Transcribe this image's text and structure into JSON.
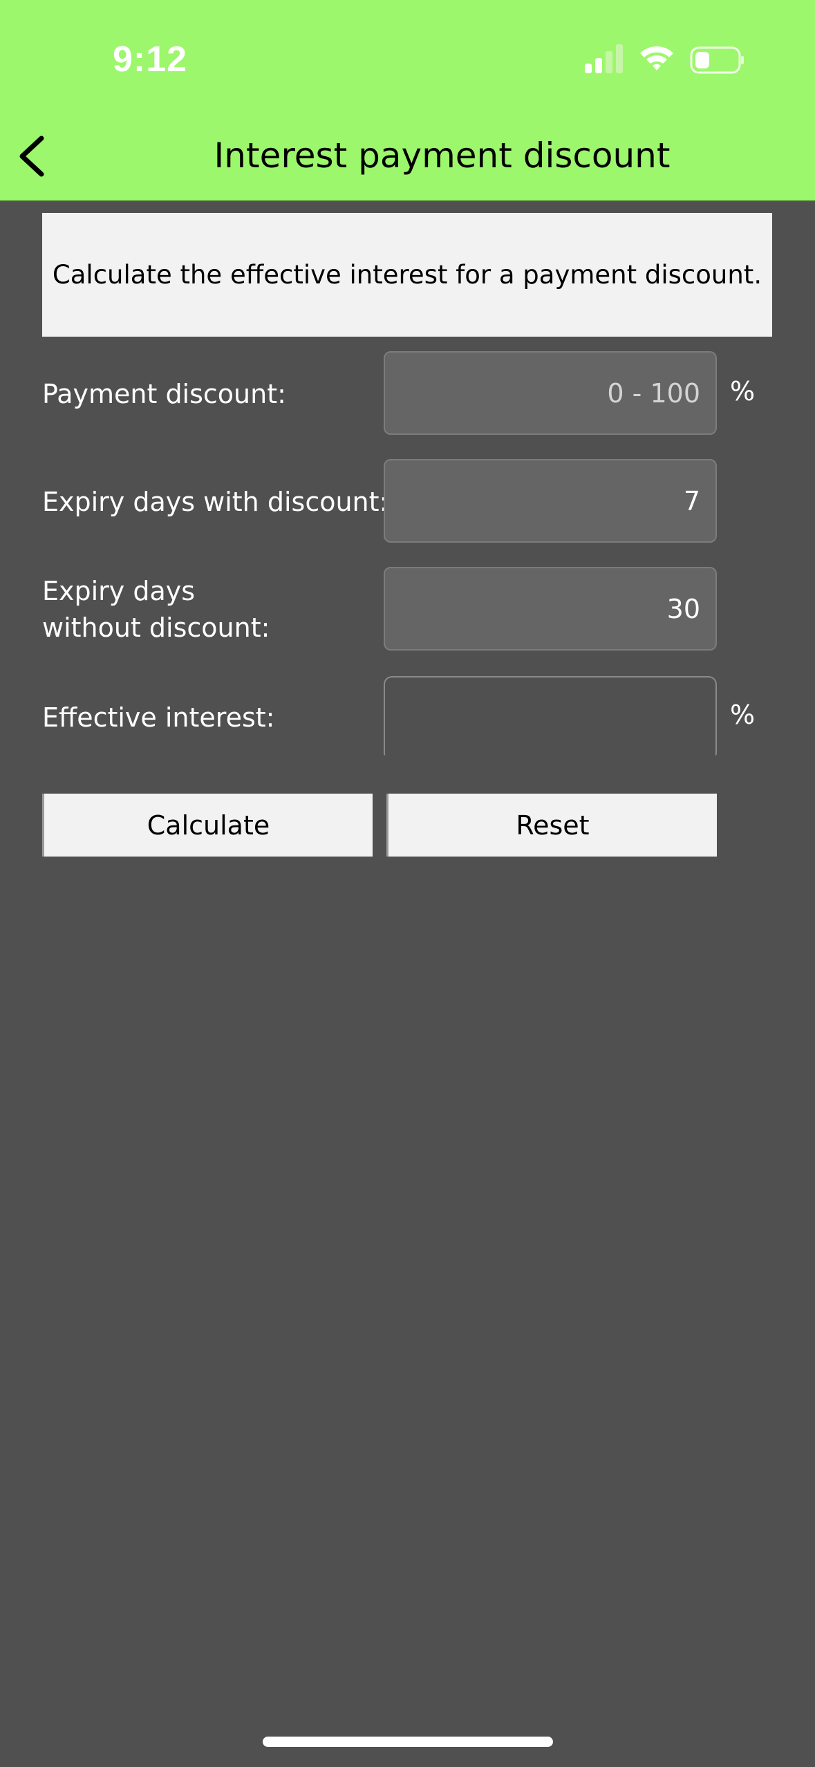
{
  "status_bar": {
    "time": "9:12",
    "icons": [
      "cellular-signal-icon",
      "wifi-icon",
      "battery-icon"
    ]
  },
  "nav": {
    "back_icon": "chevron-left-icon",
    "title": "Interest payment discount"
  },
  "info": {
    "text": "Calculate the effective interest for a payment discount."
  },
  "form": {
    "payment_discount": {
      "label": "Payment discount:",
      "value": "",
      "placeholder": "0 - 100",
      "unit": "%"
    },
    "expiry_with_discount": {
      "label": "Expiry days with discount:",
      "value": "7"
    },
    "expiry_without_discount": {
      "label_line1": "Expiry days",
      "label_line2": "without discount:",
      "value": "30"
    },
    "effective_interest": {
      "label": "Effective interest:",
      "value": "",
      "unit": "%"
    }
  },
  "buttons": {
    "calculate": "Calculate",
    "reset": "Reset"
  },
  "colors": {
    "header": "#9df76c",
    "background": "#505050",
    "field": "#656565",
    "button": "#f2f2f2"
  }
}
